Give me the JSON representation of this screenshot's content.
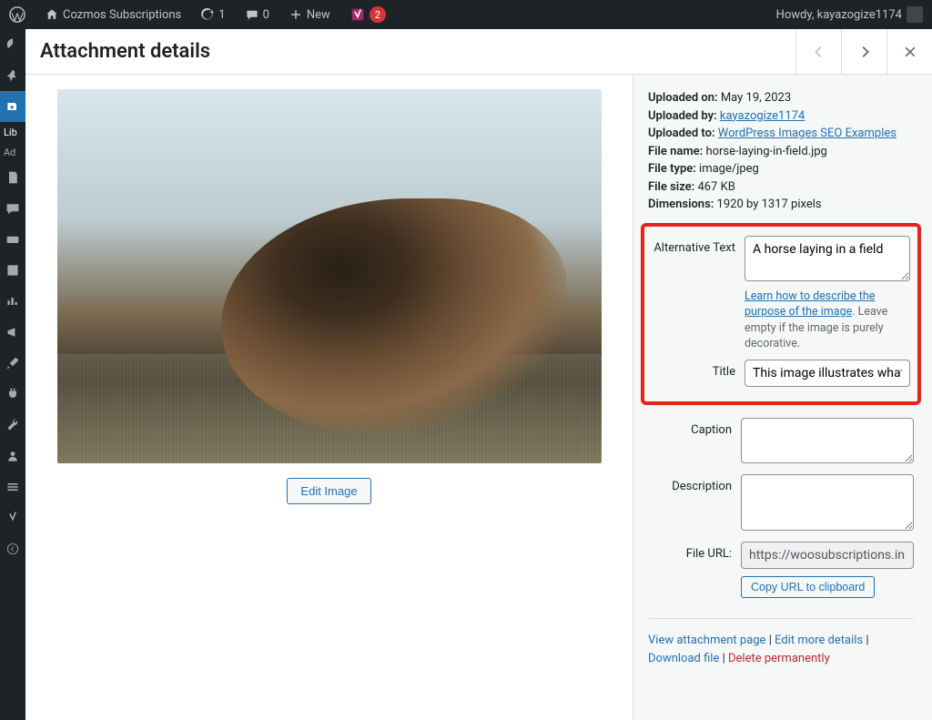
{
  "admin_bar": {
    "site_name": "Cozmos Subscriptions",
    "updates_count": "1",
    "comments_count": "0",
    "new_label": "New",
    "yoast_count": "2",
    "howdy": "Howdy, kayazogize1174"
  },
  "sidebar": {
    "library_label": "Lib",
    "addnew_label": "Ad"
  },
  "modal": {
    "title": "Attachment details"
  },
  "meta": {
    "uploaded_on_label": "Uploaded on:",
    "uploaded_on": "May 19, 2023",
    "uploaded_by_label": "Uploaded by:",
    "uploaded_by": "kayazogize1174",
    "uploaded_to_label": "Uploaded to:",
    "uploaded_to": "WordPress Images SEO Examples",
    "file_name_label": "File name:",
    "file_name": "horse-laying-in-field.jpg",
    "file_type_label": "File type:",
    "file_type": "image/jpeg",
    "file_size_label": "File size:",
    "file_size": "467 KB",
    "dimensions_label": "Dimensions:",
    "dimensions": "1920 by 1317 pixels"
  },
  "fields": {
    "alt_label": "Alternative Text",
    "alt_value": "A horse laying in a field",
    "alt_help_link": "Learn how to describe the purpose of the image",
    "alt_help_tail": ". Leave empty if the image is purely decorative.",
    "title_label": "Title",
    "title_value": "This image illustrates what a",
    "caption_label": "Caption",
    "caption_value": "",
    "description_label": "Description",
    "description_value": "",
    "file_url_label": "File URL:",
    "file_url_value": "https://woosubscriptions.inst",
    "copy_url_label": "Copy URL to clipboard"
  },
  "actions": {
    "view": "View attachment page",
    "edit_more": "Edit more details",
    "download": "Download file",
    "delete": "Delete permanently"
  },
  "preview": {
    "edit_image_label": "Edit Image"
  }
}
